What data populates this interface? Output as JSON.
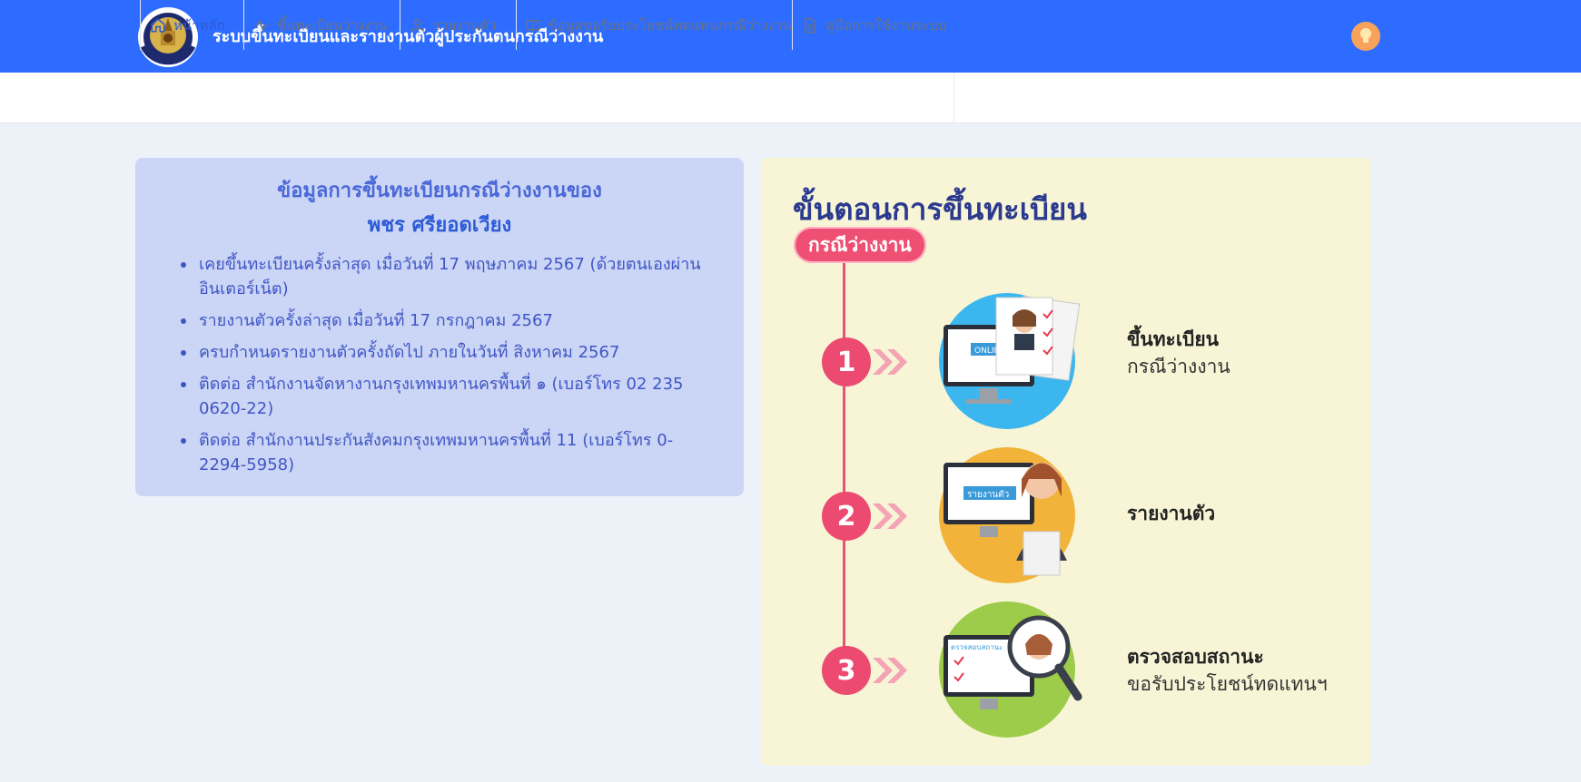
{
  "header": {
    "title": "ระบบขึ้นทะเบียนและรายงานตัวผู้ประกันตนกรณีว่างงาน",
    "logo_text": "กรมการจัดหางาน"
  },
  "nav": {
    "items": [
      {
        "label": "หน้าหลัก",
        "icon": "home-icon",
        "active": true
      },
      {
        "label": "ขึ้นทะเบียนว่างงาน",
        "icon": "activity-icon"
      },
      {
        "label": "รายงานตัว",
        "icon": "user-icon"
      },
      {
        "label": "ข้อมูลขอรับประโยชน์ทดแทนกรณีว่างงาน",
        "icon": "book-icon"
      },
      {
        "label": "คู่มือการใช้งานระบบ",
        "icon": "document-icon"
      }
    ]
  },
  "info": {
    "title": "ข้อมูลการขึ้นทะเบียนกรณีว่างงานของ",
    "name": "พชร ศรียอดเวียง",
    "items": [
      "เคยขึ้นทะเบียนครั้งล่าสุด เมื่อวันที่ 17 พฤษภาคม 2567 (ด้วยตนเองผ่านอินเตอร์เน็ต)",
      "รายงานตัวครั้งล่าสุด เมื่อวันที่ 17 กรกฎาคม 2567",
      "ครบกำหนดรายงานตัวครั้งถัดไป ภายในวันที่ สิงหาคม 2567",
      "ติดต่อ สำนักงานจัดหางานกรุงเทพมหานครพื้นที่ ๑ (เบอร์โทร 02 235 0620-22)",
      "ติดต่อ สำนักงานประกันสังคมกรุงเทพมหานครพื้นที่ 11 (เบอร์โทร 0-2294-5958)"
    ]
  },
  "steps": {
    "heading": "ขั้นตอนการขึ้นทะเบียน",
    "pill": "กรณีว่างงาน",
    "list": [
      {
        "number": "1",
        "bold": "ขึ้นทะเบียน",
        "normal": "กรณีว่างงาน",
        "illus_text": "ONLINE REGIST",
        "circle_color": "#3cb6ee"
      },
      {
        "number": "2",
        "bold": "รายงานตัว",
        "normal": "",
        "illus_text": "รายงานตัว",
        "circle_color": "#f2b33a"
      },
      {
        "number": "3",
        "bold": "ตรวจสอบสถานะ",
        "normal": "ขอรับประโยชน์ทดแทนฯ",
        "illus_text": "ตรวจสอบสถานะ",
        "circle_color": "#9ccc4a"
      }
    ]
  },
  "colors": {
    "header_bg": "#2d6cff",
    "card_bg": "#cbd5f5",
    "accent_pink": "#ec4a70",
    "panel_bg": "#f7f5d6"
  }
}
